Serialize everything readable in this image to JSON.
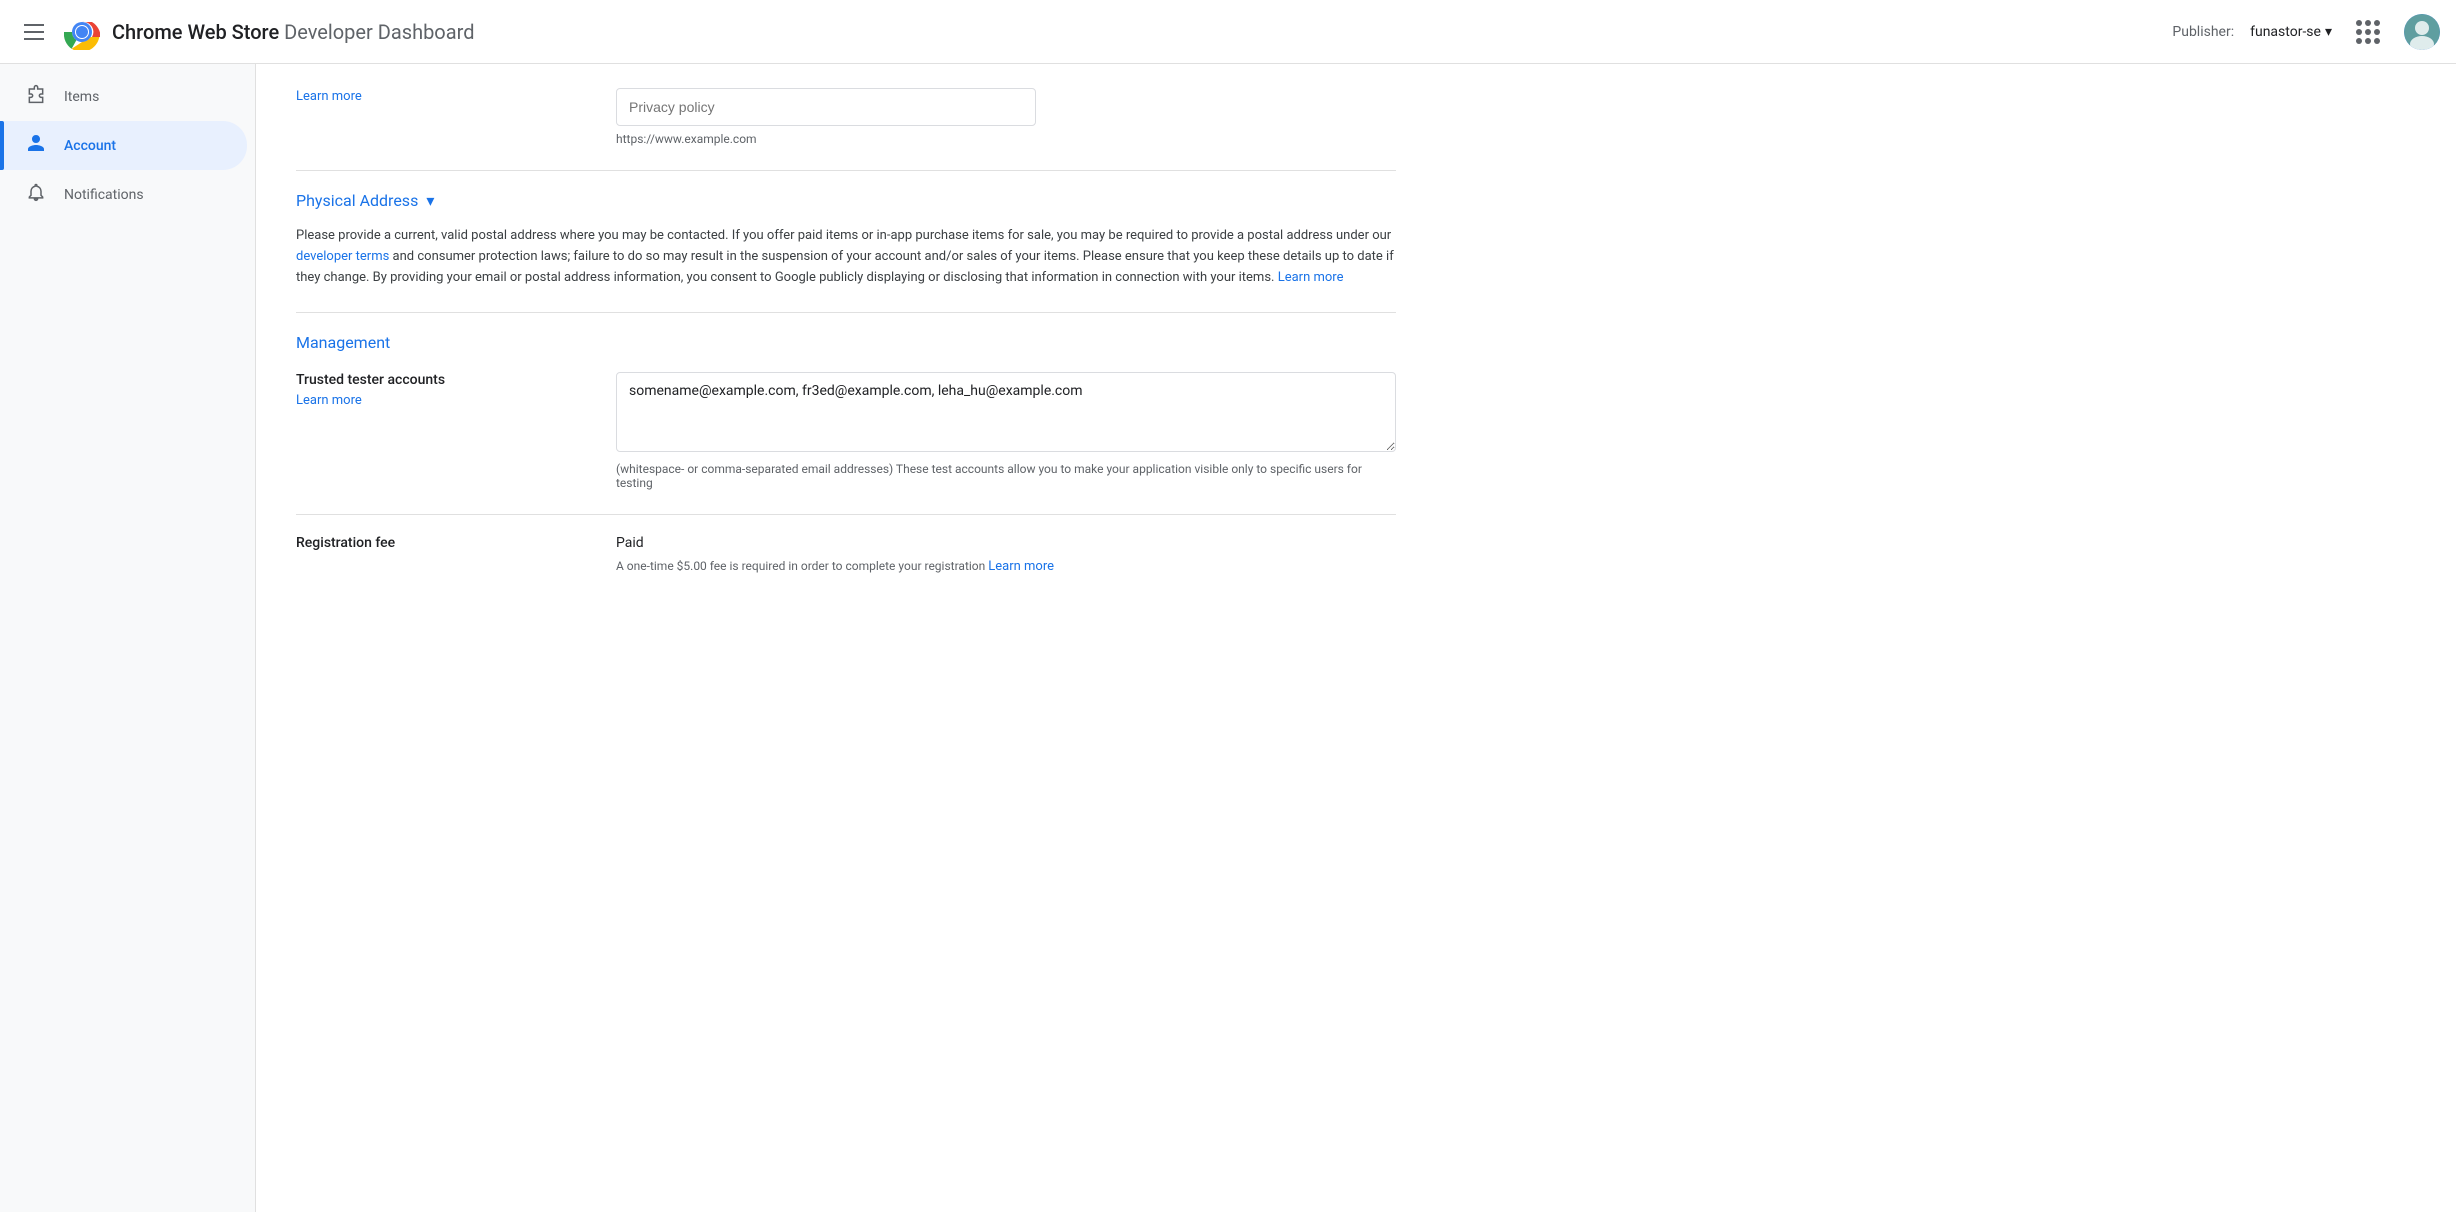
{
  "header": {
    "menu_icon": "menu",
    "app_name": "Chrome Web Store",
    "app_subtitle": "Developer Dashboard",
    "publisher_label": "Publisher:",
    "publisher_name": "funastor-se",
    "grid_icon": "grid",
    "avatar_alt": "User avatar"
  },
  "sidebar": {
    "items": [
      {
        "id": "items",
        "label": "Items",
        "icon": "puzzle",
        "active": false
      },
      {
        "id": "account",
        "label": "Account",
        "icon": "person",
        "active": true
      },
      {
        "id": "notifications",
        "label": "Notifications",
        "icon": "bell",
        "active": false
      }
    ]
  },
  "main": {
    "privacy_policy": {
      "learn_more_label": "Learn more",
      "input_placeholder": "Privacy policy",
      "input_hint": "https://www.example.com"
    },
    "physical_address": {
      "title": "Physical Address",
      "chevron": "▾",
      "description": "Please provide a current, valid postal address where you may be contacted. If you offer paid items or in-app purchase items for sale, you may be required to provide a postal address under our",
      "developer_terms_link": "developer terms",
      "description_mid": "and consumer protection laws; failure to do so may result in the suspension of your account and/or sales of your items. Please ensure that you keep these details up to date if they change. By providing your email or postal address information, you consent to Google publicly displaying or disclosing that information in connection with your items.",
      "learn_more_link": "Learn more"
    },
    "management": {
      "title": "Management",
      "trusted_tester": {
        "label": "Trusted tester accounts",
        "learn_more_label": "Learn more",
        "value": "somename@example.com, fr3ed@example.com, leha_hu@example.com",
        "hint": "(whitespace- or comma-separated email addresses) These test accounts allow you to make your application visible only to specific users for testing"
      },
      "registration_fee": {
        "label": "Registration fee",
        "value": "Paid",
        "description": "A one-time $5.00 fee is required in order to complete your registration",
        "learn_more_link": "Learn more"
      }
    }
  }
}
